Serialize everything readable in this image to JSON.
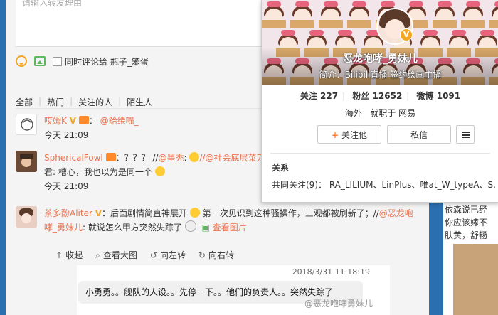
{
  "composer": {
    "placeholder": "请输入转发理由",
    "also_comment_label": "同时评论给 瓶子_笨蛋"
  },
  "filters": [
    "全部",
    "热门",
    "关注的人",
    "陌生人"
  ],
  "comments": [
    {
      "user": "哎姆K",
      "mention": "@鲐绻喵_",
      "time": "今天 21:09"
    },
    {
      "user": "SphericalFowl",
      "text1": "：？？？ //",
      "mention1": "@墨秃",
      "text2": ":",
      "mention2": "//@社会底层菜刀浦",
      "line2": "君: 槽心，我也以为是同一个",
      "time": "今天 21:09"
    },
    {
      "user": "茶多酚Aliter",
      "text1": "：后面剧情简直神展开",
      "text2": "第一次见识到这种骚操作，三观都被刷新了；//",
      "mention1": "@恶龙咆",
      "mention1b": "哮_勇妹儿",
      "text3": ": 就说怎么甲方突然失踪了",
      "view_image": "查看图片"
    }
  ],
  "actions": [
    "收起",
    "查看大图",
    "向左转",
    "向右转"
  ],
  "preview": {
    "date": "2018/3/31 11:18:19",
    "message": "小勇勇。。舰队的人设。。先停一下。。他们的负责人。。突然失踪了"
  },
  "watermark": "@恶龙咆哮勇妹儿",
  "right_column": {
    "lines": [
      "依森说已经",
      "你应该嫁不",
      "肤黄，舒畅"
    ]
  },
  "profile_card": {
    "name": "恶龙咆哮_勇妹儿",
    "intro": "简介：Bilibili直播 签约绘画主播",
    "follow_label": "关注",
    "follow_count": "227",
    "fans_label": "粉丝",
    "fans_count": "12652",
    "weibo_label": "微博",
    "weibo_count": "1091",
    "location": "海外",
    "job": "就职于 网易",
    "follow_button": "关注他",
    "message_button": "私信",
    "relations_title": "关系",
    "mutual": "共同关注(9)：  RA_LILIUM、LinPlus、唯at_W_typeA、S..."
  },
  "colors": {
    "accent": "#eb7350",
    "vip_orange": "#f5a623",
    "weibo_blue": "#2a6fb0"
  }
}
